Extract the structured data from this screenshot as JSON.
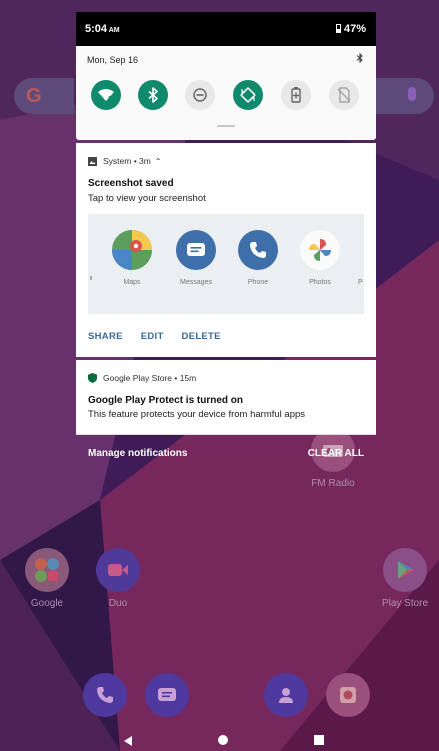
{
  "status_bar": {
    "time": "5:04",
    "ampm": "AM",
    "battery": "47%",
    "battery_icon": "battery-icon"
  },
  "quick_settings": {
    "date": "Mon, Sep 16",
    "tiles": [
      {
        "name": "wifi-tile",
        "icon": "wifi-icon",
        "state": "on"
      },
      {
        "name": "bluetooth-tile",
        "icon": "bluetooth-icon",
        "state": "on"
      },
      {
        "name": "dnd-tile",
        "icon": "do-not-disturb-icon",
        "state": "off"
      },
      {
        "name": "auto-rotate-tile",
        "icon": "auto-rotate-icon",
        "state": "on"
      },
      {
        "name": "battery-saver-tile",
        "icon": "battery-saver-icon",
        "state": "off"
      },
      {
        "name": "sim-tile",
        "icon": "no-sim-icon",
        "state": "off"
      }
    ]
  },
  "notification_screenshot": {
    "app": "System",
    "meta": "3m",
    "title": "Screenshot saved",
    "text": "Tap to view your screenshot",
    "preview_apps": [
      {
        "label": "Maps",
        "icon": "maps-icon"
      },
      {
        "label": "Messages",
        "icon": "messages-icon"
      },
      {
        "label": "Phone",
        "icon": "phone-icon"
      },
      {
        "label": "Photos",
        "icon": "photos-icon"
      }
    ],
    "actions": [
      "SHARE",
      "EDIT",
      "DELETE"
    ]
  },
  "notification_play_protect": {
    "app": "Google Play Store",
    "meta": "15m",
    "title": "Google Play Protect is turned on",
    "text": "This feature protects your device from harmful apps"
  },
  "shade_footer": {
    "manage": "Manage notifications",
    "clear_all": "CLEAR ALL"
  },
  "home_screen": {
    "apps": [
      {
        "label": "FM Radio",
        "icon": "fm-radio-icon"
      },
      {
        "label": "Google",
        "icon": "google-folder-icon"
      },
      {
        "label": "Duo",
        "icon": "duo-icon"
      },
      {
        "label": "Play Store",
        "icon": "play-store-icon"
      }
    ],
    "dock": [
      {
        "icon": "phone-icon"
      },
      {
        "icon": "messages-icon"
      },
      {
        "icon": "contacts-icon"
      },
      {
        "icon": "camera-icon"
      }
    ]
  },
  "colors": {
    "accent_teal": "#0f8a6c",
    "action_blue": "#3a6a9c",
    "wallpaper_purple": "#5a2a7a"
  }
}
